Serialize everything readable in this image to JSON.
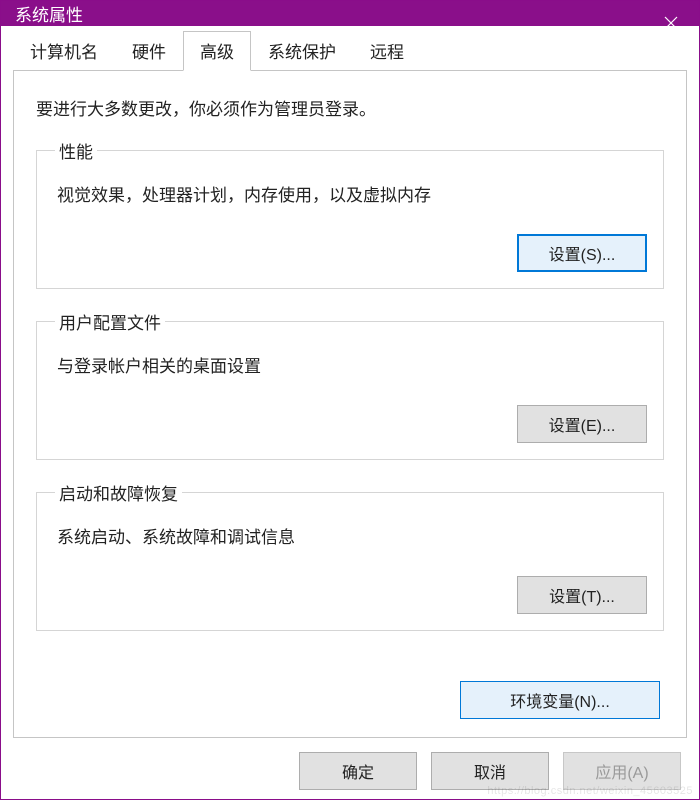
{
  "titlebar": {
    "title": "系统属性"
  },
  "tabs": {
    "items": [
      {
        "label": "计算机名"
      },
      {
        "label": "硬件"
      },
      {
        "label": "高级"
      },
      {
        "label": "系统保护"
      },
      {
        "label": "远程"
      }
    ],
    "active_index": 2
  },
  "advanced": {
    "admin_note": "要进行大多数更改，你必须作为管理员登录。",
    "performance": {
      "legend": "性能",
      "desc": "视觉效果，处理器计划，内存使用，以及虚拟内存",
      "button": "设置(S)..."
    },
    "profiles": {
      "legend": "用户配置文件",
      "desc": "与登录帐户相关的桌面设置",
      "button": "设置(E)..."
    },
    "startup": {
      "legend": "启动和故障恢复",
      "desc": "系统启动、系统故障和调试信息",
      "button": "设置(T)..."
    },
    "env_button": "环境变量(N)..."
  },
  "footer": {
    "ok": "确定",
    "cancel": "取消",
    "apply": "应用(A)"
  },
  "colors": {
    "accent": "#8a0f8a",
    "focus_blue": "#0078d7",
    "arrow": "#a4121a"
  },
  "watermark": "https://blog.csdn.net/weixin_45603525"
}
